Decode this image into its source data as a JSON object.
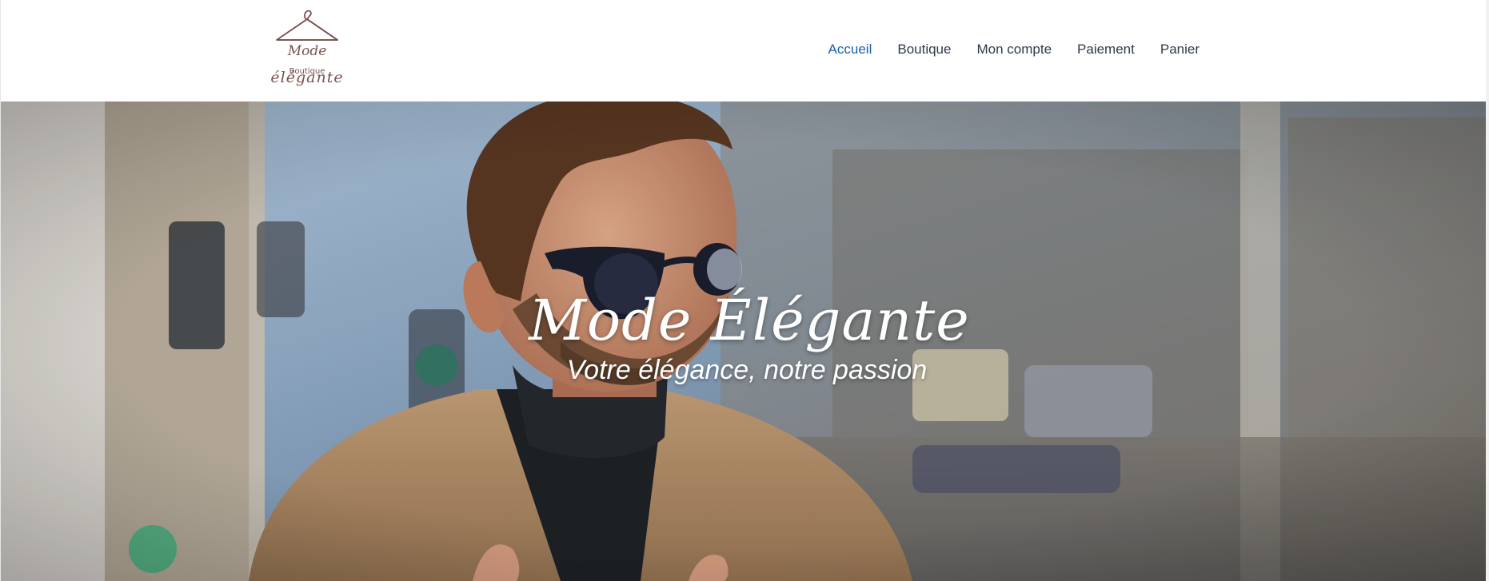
{
  "header": {
    "logo": {
      "line1": "Mode",
      "line2": "Boutique",
      "line3": "élégante",
      "icon": "hanger-icon"
    },
    "nav": [
      {
        "label": "Accueil",
        "active": true
      },
      {
        "label": "Boutique",
        "active": false
      },
      {
        "label": "Mon compte",
        "active": false
      },
      {
        "label": "Paiement",
        "active": false
      },
      {
        "label": "Panier",
        "active": false
      }
    ]
  },
  "hero": {
    "title": "Mode Élégante",
    "subtitle": "Votre élégance, notre passion"
  },
  "colors": {
    "nav_active": "#1b5fa8",
    "nav_text": "#2c3a4b",
    "logo": "#7a5050",
    "hero_text": "#ffffff"
  }
}
